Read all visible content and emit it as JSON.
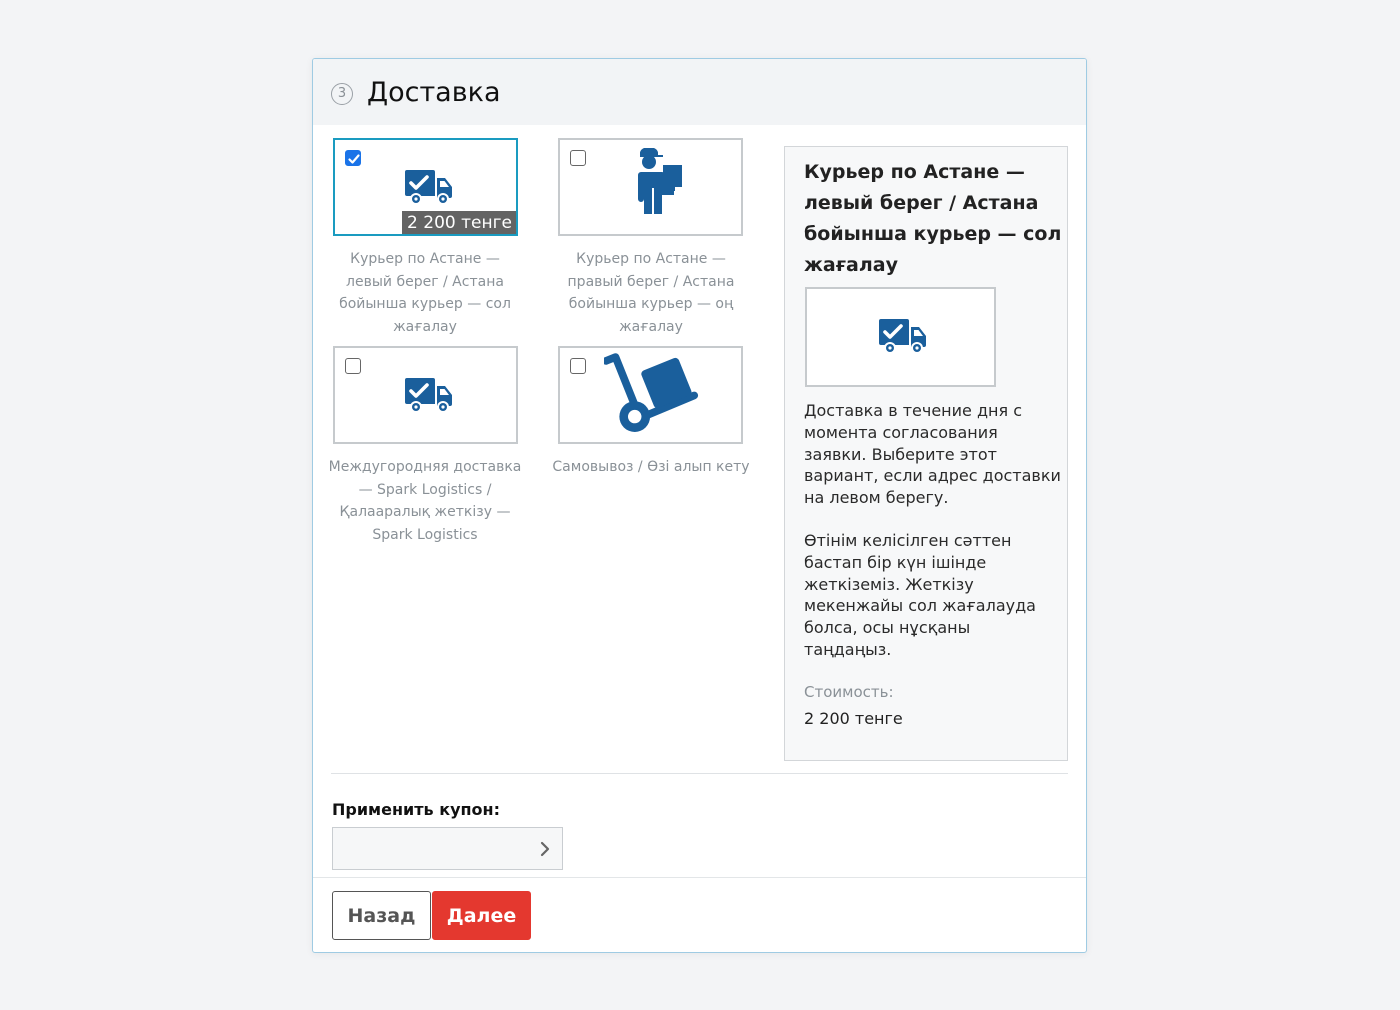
{
  "step": {
    "number": "3",
    "title": "Доставка"
  },
  "options": [
    {
      "id": "courier-left",
      "caption": "Курьер по Астане — левый берег / Астана бойынша курьер — сол жағалау",
      "selected": true,
      "price": "2 200 тенге",
      "icon": "truck-check-icon"
    },
    {
      "id": "courier-right",
      "caption": "Курьер по Астане — правый берег / Астана бойынша курьер — оң жағалау",
      "selected": false,
      "icon": "courier-person-icon"
    },
    {
      "id": "intercity",
      "caption": "Междугородняя доставка — Spark Logistics / Қалааралық жеткізу — Spark Logistics",
      "selected": false,
      "icon": "truck-check-icon"
    },
    {
      "id": "pickup",
      "caption": "Самовывоз / Өзі алып кету",
      "selected": false,
      "icon": "hand-truck-icon"
    }
  ],
  "detail": {
    "title": "Курьер по Астане — левый берег / Астана бойынша курьер — сол жағалау",
    "description_ru": "Доставка в течение дня с момента согласования заявки. Выберите этот вариант, если адрес доставки на левом берегу.",
    "description_kz": "Өтінім келісілген сәттен бастап бір күн ішінде жеткіземіз. Жеткізу мекенжайы сол жағалауда болса, осы нұсқаны таңдаңыз.",
    "cost_label": "Стоимость:",
    "cost_value": "2 200 тенге",
    "icon": "truck-check-icon"
  },
  "coupon": {
    "label": "Применить купон:",
    "value": "",
    "placeholder": ""
  },
  "buttons": {
    "back": "Назад",
    "next": "Далее"
  },
  "colors": {
    "icon_blue": "#1a5f9c",
    "selected_border": "#1a9bc0",
    "next_button": "#e4382f",
    "checkbox_on": "#1a73e8"
  }
}
